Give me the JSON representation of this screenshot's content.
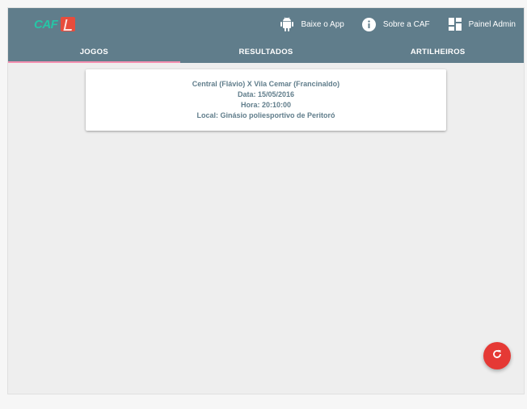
{
  "header": {
    "logo_text": "CAF",
    "actions": [
      {
        "label": "Baixe o App",
        "icon": "android-icon"
      },
      {
        "label": "Sobre a CAF",
        "icon": "info-icon"
      },
      {
        "label": "Painel Admin",
        "icon": "dashboard-icon"
      }
    ]
  },
  "tabs": [
    {
      "label": "JOGOS",
      "active": true
    },
    {
      "label": "RESULTADOS",
      "active": false
    },
    {
      "label": "ARTILHEIROS",
      "active": false
    }
  ],
  "games": [
    {
      "match": "Central (Flávio) X Vila Cemar (Francinaldo)",
      "date": "Data: 15/05/2016",
      "time": "Hora: 20:10:00",
      "location": "Local: Ginásio poliesportivo de Peritoró"
    }
  ],
  "fab": {
    "icon": "refresh-icon"
  },
  "colors": {
    "primary": "#607d8b",
    "accent": "#e53935",
    "tab_indicator": "#f48fb1",
    "logo": "#26c6a6"
  }
}
